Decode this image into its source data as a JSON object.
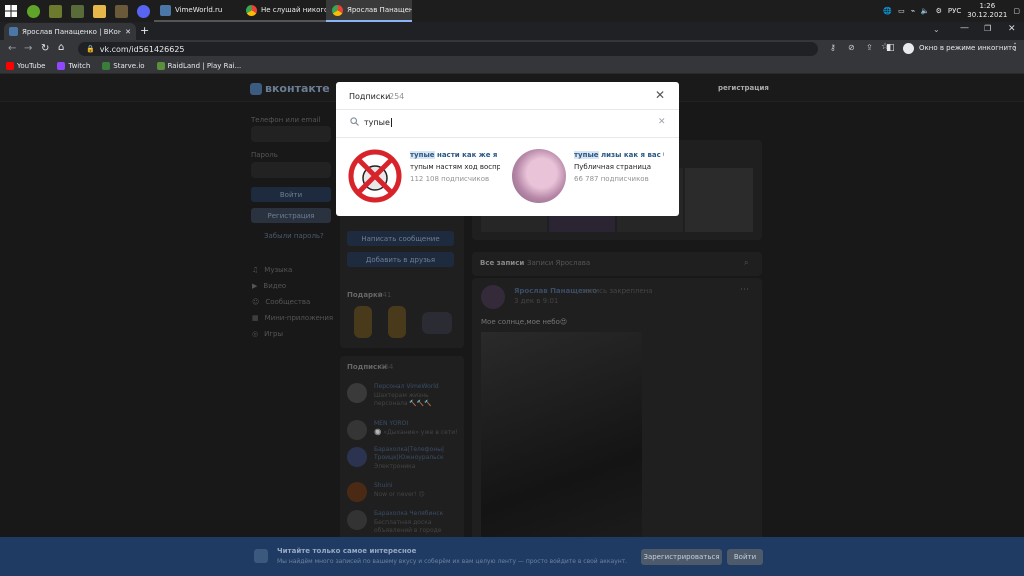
{
  "taskbar": {
    "tasks": [
      {
        "label": "VimeWorld.ru"
      },
      {
        "label": "Не слушай никого..."
      },
      {
        "label": "Ярослав Панащен..."
      }
    ],
    "tray": {
      "lang": "РУС",
      "time": "1:26",
      "date": "30.12.2021"
    }
  },
  "browser": {
    "tab_title": "Ярослав Панащенко | ВКонтакте",
    "url": "vk.com/id561426625",
    "incognito_label": "Окно в режиме инкогнито",
    "bookmarks": [
      {
        "label": "YouTube",
        "color": "#ff0000"
      },
      {
        "label": "Twitch",
        "color": "#9146ff"
      },
      {
        "label": "Starve.io",
        "color": "#3a7d3a"
      },
      {
        "label": "RaidLand | Play Rai...",
        "color": "#5a8f3c"
      }
    ]
  },
  "vk": {
    "logo": "вконтакте",
    "register_link": "регистрация",
    "login": {
      "phone_label": "Телефон или email",
      "password_label": "Пароль",
      "login_button": "Войти",
      "register_button": "Регистрация",
      "forgot": "Забыли пароль?"
    },
    "menu": [
      "Музыка",
      "Видео",
      "Сообщества",
      "Мини-приложения",
      "Игры"
    ],
    "profile_buttons": {
      "message": "Написать сообщение",
      "add_friend": "Добавить в друзья"
    },
    "gifts": {
      "title": "Подарки",
      "count": "141"
    },
    "subs_block": {
      "title": "Подписки",
      "count": "254",
      "items": [
        {
          "name": "Персонал VimeWorld",
          "desc": "Шахтерам жизнь персонала 🔨🔨🔨"
        },
        {
          "name": "MEN YOROI",
          "desc": "🔘 «Дыхание» уже в сети!"
        },
        {
          "name": "Барахолка|Телефоны| Троицк|Южноуральск",
          "desc": "Электроника"
        },
        {
          "name": "Shuini",
          "desc": "Now or never! 🙃"
        },
        {
          "name": "Барахолка Челябинск",
          "desc": "Бесплатная доска объявлений в городе"
        }
      ]
    },
    "wall": {
      "tabs": [
        "Все записи",
        "Записи Ярослава"
      ],
      "author": "Ярослав Панащенко",
      "pinned": "запись закреплена",
      "date": "3 дек в 9:01",
      "text": "Мое солнце,мое небо😍"
    },
    "banner": {
      "title": "Читайте только самое интересное",
      "text": "Мы найдём много записей по вашему вкусу и соберём их вам целую ленту — просто войдите в свой аккаунт.",
      "register": "Зарегистрироваться",
      "login": "Войти"
    }
  },
  "modal": {
    "title": "Подписки",
    "count": "254",
    "search_value": "тупые",
    "results": [
      {
        "title_hl": "тупые",
        "title_rest": " насти как же я вас ...",
        "desc": "тупым настям ход воспре...",
        "followers": "112 108 подписчиков"
      },
      {
        "title_hl": "тупые",
        "title_rest": " лизы как я вас блин...",
        "desc": "Публичная страница",
        "followers": "66 787 подписчиков"
      }
    ]
  }
}
